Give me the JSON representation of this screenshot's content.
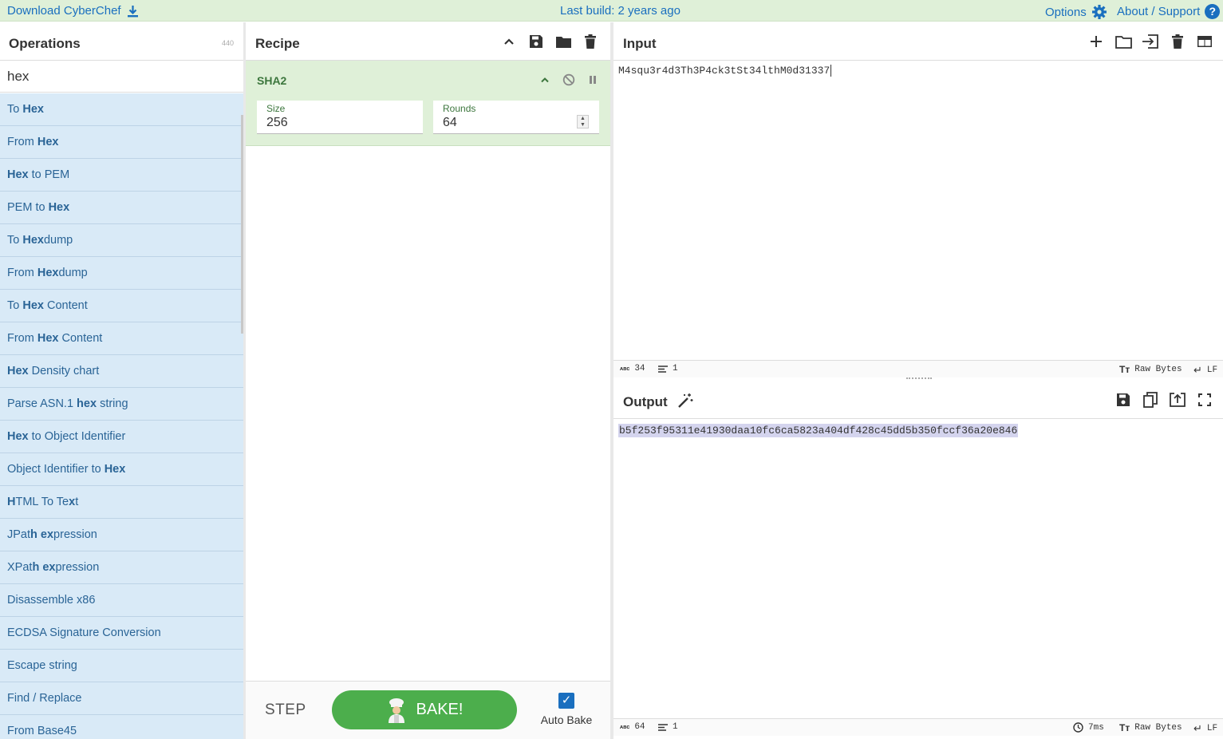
{
  "topbar": {
    "download_label": "Download CyberChef",
    "build_label": "Last build: 2 years ago",
    "options_label": "Options",
    "about_label": "About / Support",
    "help_glyph": "?"
  },
  "operations": {
    "title": "Operations",
    "count": "440",
    "search_value": "hex",
    "items": [
      {
        "pre": "To ",
        "b": "Hex",
        "post": ""
      },
      {
        "pre": "From ",
        "b": "Hex",
        "post": ""
      },
      {
        "pre": "",
        "b": "Hex",
        "post": " to PEM"
      },
      {
        "pre": "PEM to ",
        "b": "Hex",
        "post": ""
      },
      {
        "pre": "To ",
        "b": "Hex",
        "post": "dump"
      },
      {
        "pre": "From ",
        "b": "Hex",
        "post": "dump"
      },
      {
        "pre": "To ",
        "b": "Hex",
        "post": " Content"
      },
      {
        "pre": "From ",
        "b": "Hex",
        "post": " Content"
      },
      {
        "pre": "",
        "b": "Hex",
        "post": " Density chart"
      },
      {
        "pre": "Parse ASN.1 ",
        "b": "hex",
        "post": " string"
      },
      {
        "pre": "",
        "b": "Hex",
        "post": " to Object Identifier"
      },
      {
        "pre": "Object Identifier to ",
        "b": "Hex",
        "post": ""
      },
      {
        "html": "<b>H</b>TML To Te<b>x</b>t"
      },
      {
        "html": "JPat<b>h</b> <b>ex</b>pression"
      },
      {
        "html": "XPat<b>h</b> <b>ex</b>pression"
      },
      {
        "pre": "Disassemble x86",
        "b": "",
        "post": ""
      },
      {
        "pre": "ECDSA Signature Conversion",
        "b": "",
        "post": ""
      },
      {
        "pre": "Escape string",
        "b": "",
        "post": ""
      },
      {
        "pre": "Find / Replace",
        "b": "",
        "post": ""
      },
      {
        "pre": "From Base45",
        "b": "",
        "post": ""
      }
    ]
  },
  "recipe": {
    "title": "Recipe",
    "operation": {
      "name": "SHA2",
      "size_label": "Size",
      "size_value": "256",
      "rounds_label": "Rounds",
      "rounds_value": "64"
    },
    "step_label": "STEP",
    "bake_label": "BAKE!",
    "autobake_label": "Auto Bake",
    "autobake_checked": true
  },
  "input": {
    "title": "Input",
    "text": "M4squ3r4d3Th3P4ck3tSt34lthM0d31337",
    "length": "34",
    "lines": "1",
    "encoding": "Raw Bytes",
    "eol": "LF"
  },
  "output": {
    "title": "Output",
    "text": "b5f253f95311e41930daa10fc6ca5823a404df428c45dd5b350fccf36a20e846",
    "length": "64",
    "lines": "1",
    "time": "7ms",
    "encoding": "Raw Bytes",
    "eol": "LF"
  },
  "colors": {
    "accent": "#1a6fbf",
    "recipe_bg": "#dff0d8",
    "operation_bg": "#d9eaf7",
    "bake_green": "#4cae4c"
  },
  "icons": [
    "download-icon",
    "gear-icon",
    "help-icon",
    "chevron-up-icon",
    "save-icon",
    "folder-icon",
    "trash-icon",
    "disable-icon",
    "pause-icon",
    "plus-icon",
    "input-file-icon",
    "trash-icon",
    "layout-icon",
    "magic-wand-icon",
    "copy-icon",
    "replace-input-icon",
    "maximise-icon",
    "chef-icon",
    "checkmark-icon"
  ]
}
